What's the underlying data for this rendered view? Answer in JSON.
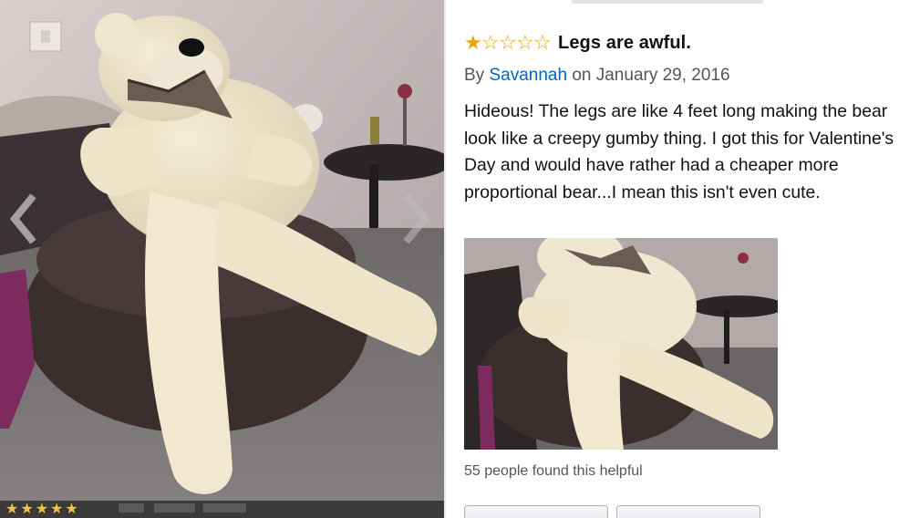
{
  "viewer": {
    "prev_icon": "chevron-left-icon",
    "next_icon": "chevron-right-icon",
    "bottom_rating_stars": 5
  },
  "review": {
    "rating": 1,
    "max_rating": 5,
    "title": "Legs are awful.",
    "by_prefix": "By",
    "author": "Savannah",
    "date_text": "on January 29, 2016",
    "body": "Hideous! The legs are like 4 feet long making the bear look like a creepy gumby thing. I got this for Valentine's Day and would have rather had a cheaper more proportional bear...I mean this isn't even cute.",
    "helpful_text": "55 people found this helpful"
  },
  "colors": {
    "star": "#e7a40f",
    "author_link": "#0066c0",
    "text": "#111111",
    "muted": "#555555"
  }
}
